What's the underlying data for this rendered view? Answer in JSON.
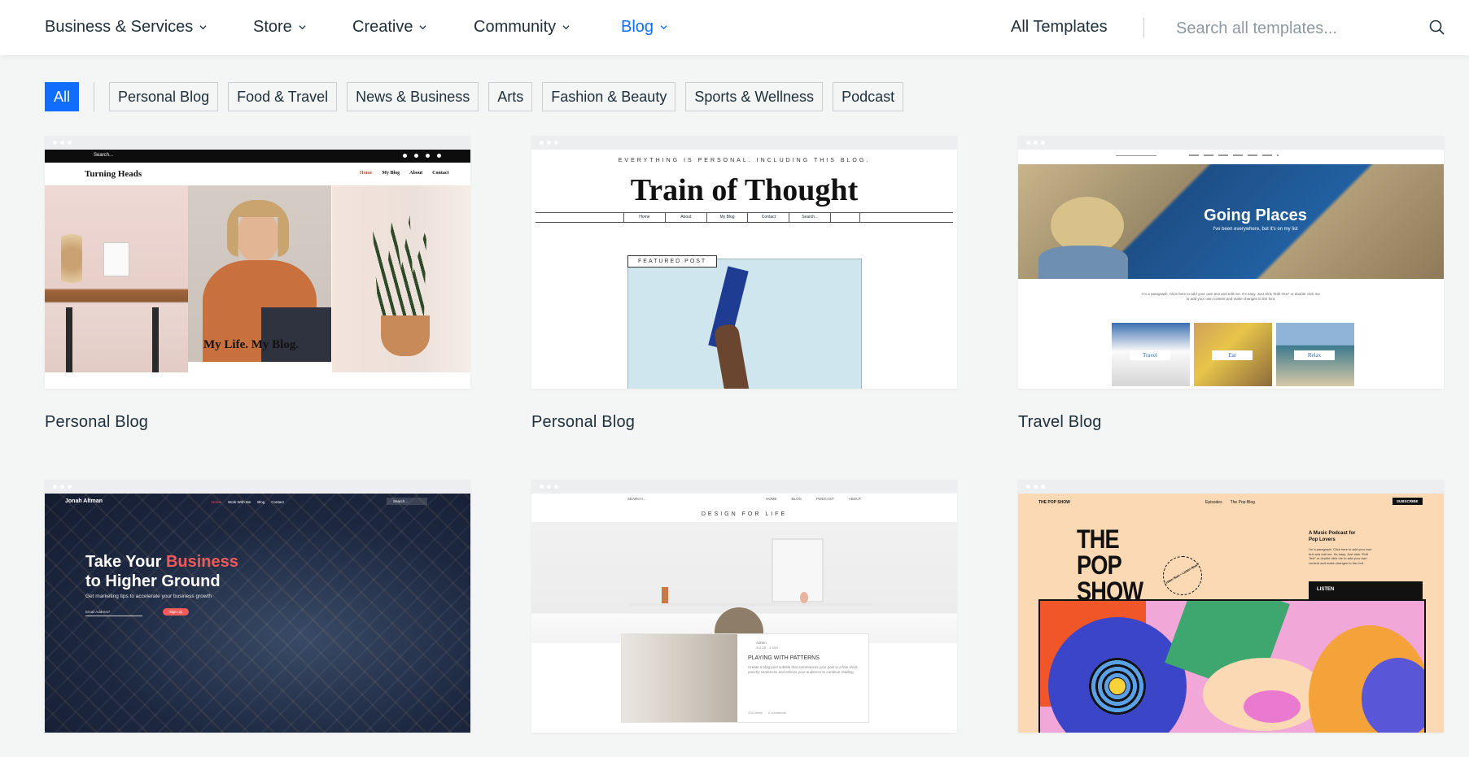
{
  "nav": {
    "items": [
      {
        "label": "Business & Services",
        "active": false
      },
      {
        "label": "Store",
        "active": false
      },
      {
        "label": "Creative",
        "active": false
      },
      {
        "label": "Community",
        "active": false
      },
      {
        "label": "Blog",
        "active": true
      }
    ],
    "all_templates": "All Templates",
    "search_placeholder": "Search all templates...",
    "accent_color": "#116dff"
  },
  "filters": [
    "All",
    "Personal Blog",
    "Food & Travel",
    "News & Business",
    "Arts",
    "Fashion & Beauty",
    "Sports & Wellness",
    "Podcast"
  ],
  "selected_filter": "All",
  "cards": [
    {
      "title": "Personal Blog",
      "preview": {
        "site_name": "Turning Heads",
        "search": "Search...",
        "menu": [
          "Home",
          "My Blog",
          "About",
          "Contact"
        ],
        "caption": "My Life. My Blog."
      }
    },
    {
      "title": "Personal Blog",
      "preview": {
        "tagline": "EVERYTHING IS PERSONAL. INCLUDING THIS BLOG.",
        "headline": "Train of Thought",
        "menu": [
          "Home",
          "About",
          "My Blog",
          "Contact",
          "Search..."
        ],
        "badge": "FEATURED POST"
      }
    },
    {
      "title": "Travel Blog",
      "preview": {
        "headline": "Going Places",
        "sub": "I've been everywhere, but it's on my list",
        "body": "I'm a paragraph. Click here to add your own text and edit me. It's easy. Just click “Edit Text” or double click me to add your own content and make changes to the font.",
        "tiles": [
          "Travel",
          "Eat",
          "Relax"
        ]
      }
    },
    {
      "title": "",
      "preview": {
        "brand": "Jonah Altman",
        "menu": [
          "Home",
          "Work With Me",
          "Blog",
          "Contact"
        ],
        "search": "Search...",
        "headline_1": "Take Your",
        "headline_accent": "Business",
        "headline_2": "to Higher Ground",
        "sub": "Get marketing tips to accelerate your business growth",
        "email_placeholder": "Email Address*",
        "cta": "Sign Up"
      }
    },
    {
      "title": "",
      "preview": {
        "search": "SEARCH...",
        "menu": [
          "HOME",
          "BLOG",
          "PODCAST",
          "ABOUT"
        ],
        "tagline": "DESIGN FOR LIFE",
        "author": "Admin",
        "date": "Jul 18 · 1 min",
        "post_title": "PLAYING WITH PATTERNS",
        "excerpt": "Create a blog post subtitle that summarizes your post in a few short, punchy sentences and entices your audience to continue reading.",
        "stats_views": "226 views",
        "stats_comments": "0 comments"
      }
    },
    {
      "title": "",
      "preview": {
        "brand": "THE POP SHOW",
        "menu": [
          "Episodes",
          "The Pop Blog"
        ],
        "cta": "SUBSCRIBE",
        "headline": "THE POP SHOW",
        "badge_text": "Listen Now • Listen Now •",
        "desc_title": "A Music Podcast for Pop Lovers",
        "desc": "I'm a paragraph. Click here to add your own text and edit me. It's easy. Just click “Edit Text” or double click me to add your own content and make changes to the font.",
        "listen": "LISTEN"
      }
    }
  ]
}
